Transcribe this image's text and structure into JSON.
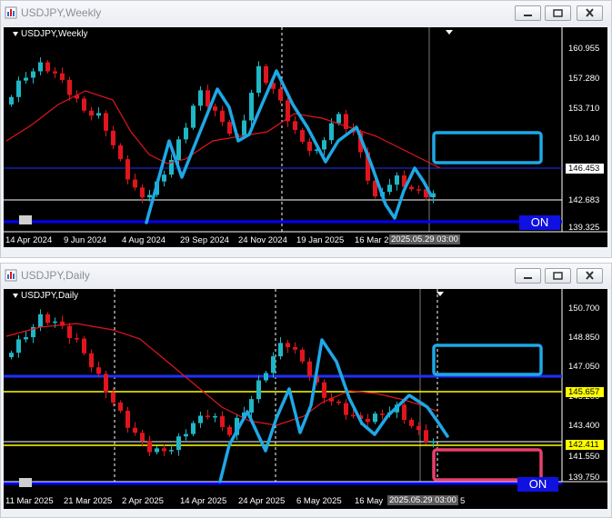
{
  "colors": {
    "bull": "#1fb7c6",
    "bear": "#e0151e",
    "ma": "#e0151e",
    "annotation_line": "#1ea8e6",
    "blue_hline": "#0000ff",
    "yellow_hline": "#ffff00",
    "white_hline": "#ffffff",
    "pink_box": "#e8406e",
    "on_button": "#1010e0"
  },
  "weekly": {
    "window_title": "USDJPY,Weekly",
    "symbol_label": "USDJPY,Weekly",
    "price_ticks": [
      "160.955",
      "157.280",
      "153.710",
      "150.140",
      "146.453",
      "142.683",
      "139.325"
    ],
    "price_badges": [
      "146.453",
      "142.683"
    ],
    "time_labels": [
      "14 Apr 2024",
      "9 Jun 2024",
      "4 Aug 2024",
      "29 Sep 2024",
      "24 Nov 2024",
      "19 Jan 2025",
      "16 Mar 20"
    ],
    "cursor_time": "2025.05.29 03:00",
    "on_button": "ON",
    "icons": [
      "window-restore-icon",
      "chart-position-icon"
    ]
  },
  "daily": {
    "window_title": "USDJPY,Daily",
    "symbol_label": "USDJPY,Daily",
    "price_ticks": [
      "150.700",
      "148.850",
      "147.050",
      "145.200",
      "143.400",
      "141.550",
      "139.750"
    ],
    "price_badges": [
      "145.657",
      "142.411"
    ],
    "time_labels": [
      "11 Mar 2025",
      "21 Mar 2025",
      "2 Apr 2025",
      "14 Apr 2025",
      "24 Apr 2025",
      "6 May 2025",
      "16 May"
    ],
    "time_label_tail": "5",
    "cursor_time": "2025.05.29 03:00",
    "on_button": "ON"
  }
}
